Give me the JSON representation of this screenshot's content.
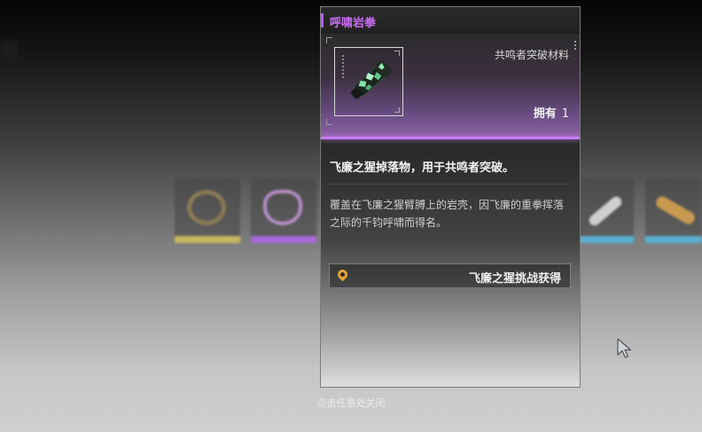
{
  "item": {
    "name": "呼啸岩拳",
    "type": "共鸣者突破材料",
    "owned_label": "拥有",
    "owned_count": "1",
    "rarity_color": "#c87cf3",
    "summary": "飞廉之猩掉落物，用于共鸣者突破。",
    "description": "覆盖在飞廉之猩臂膊上的岩壳，因飞廉的重拳挥落之际的千钧呼啸而得名。",
    "icon": "rock-gauntlet-icon"
  },
  "source": {
    "label": "飞廉之猩挑战获得",
    "icon": "location-pin-icon",
    "icon_color": "#e8a23a"
  },
  "close_hint": "点击任意处关闭",
  "background_items": [
    {
      "icon": "gold-ring-icon",
      "rarity_color": "#d8c060"
    },
    {
      "icon": "purple-wings-icon",
      "rarity_color": "#b070e0"
    },
    {
      "icon": "syringe-icon",
      "rarity_color": "#60b8d8"
    },
    {
      "icon": "orange-capsule-icon",
      "rarity_color": "#60b8d8"
    }
  ]
}
